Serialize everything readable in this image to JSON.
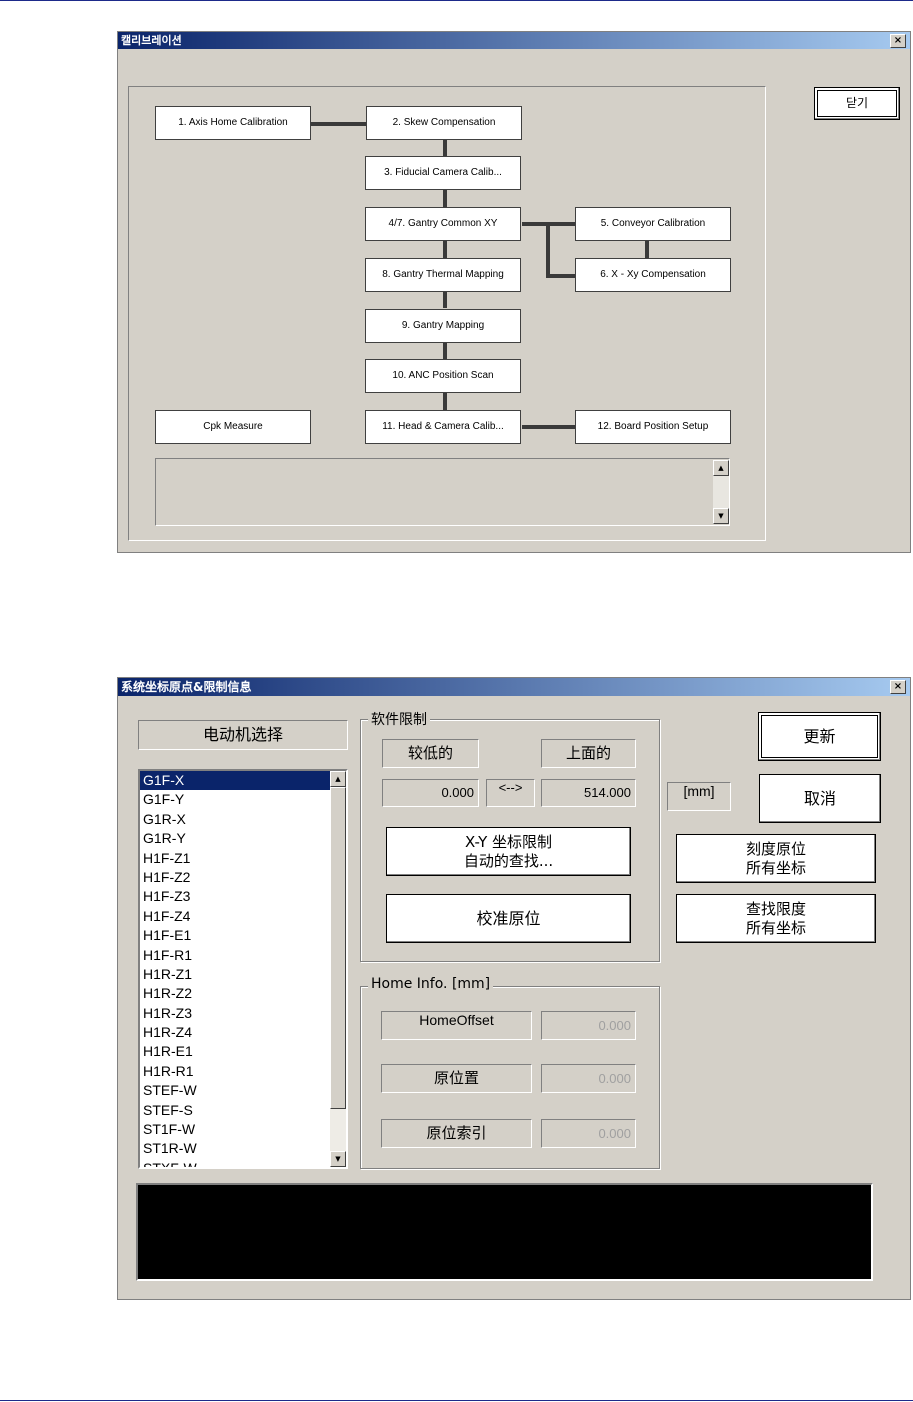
{
  "calibration_dialog": {
    "title": "캘리브레이션",
    "close_label": "닫기",
    "steps": {
      "s1": "1. Axis Home Calibration",
      "s2": "2. Skew Compensation",
      "s3": "3. Fiducial Camera Calib...",
      "s4": "4/7. Gantry Common XY",
      "s5": "5. Conveyor Calibration",
      "s6": "6. X - Xy Compensation",
      "s8": "8. Gantry Thermal Mapping",
      "s9": "9. Gantry Mapping",
      "s10": "10. ANC Position Scan",
      "s11": "11. Head & Camera Calib...",
      "s12": "12. Board Position Setup",
      "cpk": "Cpk Measure"
    }
  },
  "coord_dialog": {
    "title": "系统坐标原点&限制信息",
    "motor_select_label": "电动机选择",
    "motors": [
      "G1F-X",
      "G1F-Y",
      "G1R-X",
      "G1R-Y",
      "H1F-Z1",
      "H1F-Z2",
      "H1F-Z3",
      "H1F-Z4",
      "H1F-E1",
      "H1F-R1",
      "H1R-Z1",
      "H1R-Z2",
      "H1R-Z3",
      "H1R-Z4",
      "H1R-E1",
      "H1R-R1",
      "STEF-W",
      "STEF-S",
      "ST1F-W",
      "ST1R-W",
      "STXF-W"
    ],
    "selected_motor": "G1F-X",
    "software_limit": {
      "legend": "软件限制",
      "lower_label": "较低的",
      "upper_label": "上面的",
      "lower_value": "0.000",
      "arrow": "<-->",
      "upper_value": "514.000",
      "unit": "[mm]",
      "auto_find_line1": "X-Y 坐标限制",
      "auto_find_line2": "自动的查找...",
      "calibrate_home": "校准原位"
    },
    "buttons": {
      "update": "更新",
      "cancel": "取消",
      "scale_home_line1": "刻度原位",
      "scale_home_line2": "所有坐标",
      "find_limit_line1": "查找限度",
      "find_limit_line2": "所有坐标"
    },
    "home_info": {
      "legend": "Home Info. [mm]",
      "offset_label": "HomeOffset",
      "offset_value": "0.000",
      "position_label": "原位置",
      "position_value": "0.000",
      "index_label": "原位索引",
      "index_value": "0.000"
    }
  }
}
